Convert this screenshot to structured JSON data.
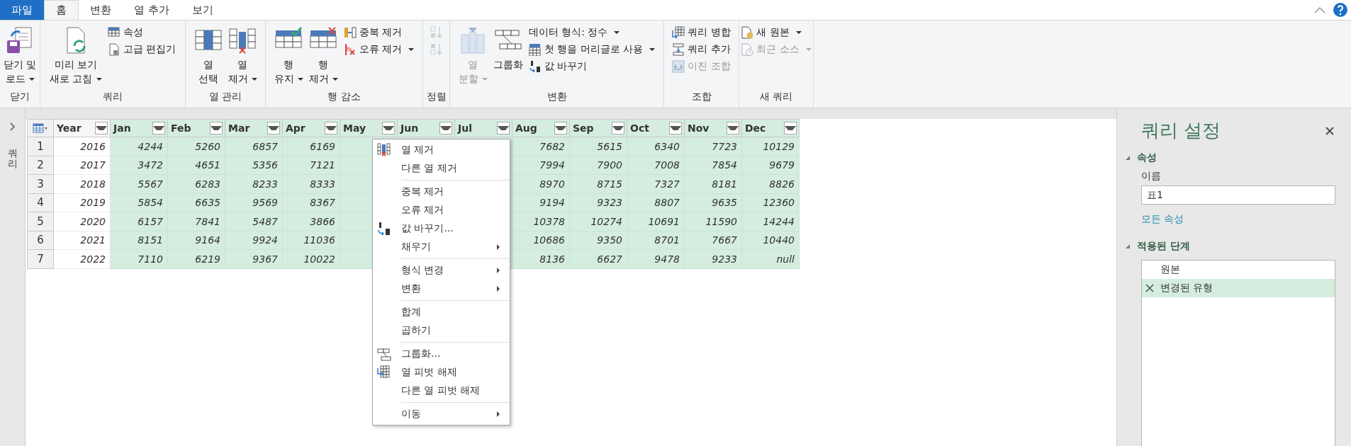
{
  "tabs": [
    {
      "label": "파일",
      "kind": "file",
      "selected": false
    },
    {
      "label": "홈",
      "kind": "tab",
      "selected": true
    },
    {
      "label": "변환",
      "kind": "tab",
      "selected": false
    },
    {
      "label": "열 추가",
      "kind": "tab",
      "selected": false
    },
    {
      "label": "보기",
      "kind": "tab",
      "selected": false
    }
  ],
  "ribbon": {
    "groups": [
      {
        "label": "닫기",
        "buttons": [
          {
            "kind": "large",
            "label": "닫기 및\n로드",
            "dropdown": true,
            "disabled": false
          }
        ]
      },
      {
        "label": "쿼리",
        "buttons": [
          {
            "kind": "large",
            "label": "미리 보기\n새로 고침",
            "dropdown": true,
            "disabled": false
          },
          {
            "kind": "small",
            "label": "속성",
            "dropdown": false,
            "disabled": false
          },
          {
            "kind": "small",
            "label": "고급 편집기",
            "dropdown": false,
            "disabled": false
          }
        ]
      },
      {
        "label": "열 관리",
        "buttons": [
          {
            "kind": "large",
            "label": "열\n선택",
            "dropdown": false,
            "disabled": false
          },
          {
            "kind": "large",
            "label": "열\n제거",
            "dropdown": true,
            "disabled": false
          }
        ]
      },
      {
        "label": "행 감소",
        "buttons": [
          {
            "kind": "large",
            "label": "행\n유지",
            "dropdown": true,
            "disabled": false
          },
          {
            "kind": "large",
            "label": "행\n제거",
            "dropdown": true,
            "disabled": false
          },
          {
            "kind": "small",
            "label": "중복 제거",
            "dropdown": false,
            "disabled": false
          },
          {
            "kind": "small",
            "label": "오류 제거",
            "dropdown": true,
            "disabled": false
          }
        ]
      },
      {
        "label": "정렬",
        "buttons": [
          {
            "kind": "icon",
            "dropdown": false,
            "disabled": true
          },
          {
            "kind": "icon",
            "dropdown": false,
            "disabled": true
          }
        ]
      },
      {
        "label": "변환",
        "buttons": [
          {
            "kind": "large",
            "label": "열\n분할",
            "dropdown": true,
            "disabled": true
          },
          {
            "kind": "large",
            "label": "그룹화",
            "dropdown": false,
            "disabled": false
          },
          {
            "kind": "small",
            "label": "데이터 형식: 정수",
            "dropdown": true,
            "disabled": false
          },
          {
            "kind": "small",
            "label": "첫 행을 머리글로 사용",
            "dropdown": true,
            "disabled": false
          },
          {
            "kind": "small",
            "label": "값 바꾸기",
            "dropdown": false,
            "disabled": false
          }
        ]
      },
      {
        "label": "조합",
        "buttons": [
          {
            "kind": "small",
            "label": "쿼리 병합",
            "dropdown": false,
            "disabled": false
          },
          {
            "kind": "small",
            "label": "쿼리 추가",
            "dropdown": false,
            "disabled": false
          },
          {
            "kind": "small",
            "label": "이진 조합",
            "dropdown": false,
            "disabled": true
          }
        ]
      },
      {
        "label": "새 쿼리",
        "buttons": [
          {
            "kind": "small",
            "label": "새 원본",
            "dropdown": true,
            "disabled": false
          },
          {
            "kind": "small",
            "label": "최근 소스",
            "dropdown": true,
            "disabled": true
          }
        ]
      }
    ]
  },
  "queries_pane": {
    "label": "쿼리"
  },
  "table": {
    "columns": [
      {
        "label": "Year",
        "selected": false
      },
      {
        "label": "Jan",
        "selected": true
      },
      {
        "label": "Feb",
        "selected": true
      },
      {
        "label": "Mar",
        "selected": true
      },
      {
        "label": "Apr",
        "selected": true
      },
      {
        "label": "May",
        "selected": true
      },
      {
        "label": "Jun",
        "selected": true
      },
      {
        "label": "Jul",
        "selected": true
      },
      {
        "label": "Aug",
        "selected": true
      },
      {
        "label": "Sep",
        "selected": true
      },
      {
        "label": "Oct",
        "selected": true
      },
      {
        "label": "Nov",
        "selected": true
      },
      {
        "label": "Dec",
        "selected": true
      }
    ],
    "rows": [
      {
        "number": "1",
        "cells": [
          "2016",
          "4244",
          "5260",
          "6857",
          "6169",
          null,
          null,
          null,
          "7682",
          "5615",
          "6340",
          "7723",
          "10129"
        ]
      },
      {
        "number": "2",
        "cells": [
          "2017",
          "3472",
          "4651",
          "5356",
          "7121",
          null,
          null,
          null,
          "7994",
          "7900",
          "7008",
          "7854",
          "9679"
        ]
      },
      {
        "number": "3",
        "cells": [
          "2018",
          "5567",
          "6283",
          "8233",
          "8333",
          null,
          null,
          null,
          "8970",
          "8715",
          "7327",
          "8181",
          "8826"
        ]
      },
      {
        "number": "4",
        "cells": [
          "2019",
          "5854",
          "6635",
          "9569",
          "8367",
          null,
          null,
          null,
          "9194",
          "9323",
          "8807",
          "9635",
          "12360"
        ]
      },
      {
        "number": "5",
        "cells": [
          "2020",
          "6157",
          "7841",
          "5487",
          "3866",
          null,
          null,
          null,
          "10378",
          "10274",
          "10691",
          "11590",
          "14244"
        ]
      },
      {
        "number": "6",
        "cells": [
          "2021",
          "8151",
          "9164",
          "9924",
          "11036",
          null,
          null,
          null,
          "10686",
          "9350",
          "8701",
          "7667",
          "10440"
        ]
      },
      {
        "number": "7",
        "cells": [
          "2022",
          "7110",
          "6219",
          "9367",
          "10022",
          null,
          null,
          null,
          "8136",
          "6627",
          "9478",
          "9233",
          "null"
        ]
      }
    ]
  },
  "context_menu": {
    "groups": [
      [
        {
          "label": "열 제거",
          "submenu": false
        },
        {
          "label": "다른 열 제거",
          "submenu": false
        }
      ],
      [
        {
          "label": "중복 제거",
          "submenu": false
        },
        {
          "label": "오류 제거",
          "submenu": false
        },
        {
          "label": "값 바꾸기...",
          "submenu": false
        },
        {
          "label": "채우기",
          "submenu": true
        }
      ],
      [
        {
          "label": "형식 변경",
          "submenu": true
        },
        {
          "label": "변환",
          "submenu": true
        }
      ],
      [
        {
          "label": "합계",
          "submenu": false
        },
        {
          "label": "곱하기",
          "submenu": false
        }
      ],
      [
        {
          "label": "그룹화...",
          "submenu": false
        },
        {
          "label": "열 피벗 해제",
          "submenu": false
        },
        {
          "label": "다른 열 피벗 해제",
          "submenu": false
        }
      ],
      [
        {
          "label": "이동",
          "submenu": true
        }
      ]
    ]
  },
  "query_settings": {
    "title": "쿼리 설정",
    "sections": [
      {
        "title": "속성",
        "expanded": true
      },
      {
        "title": "적용된 단계",
        "expanded": true
      }
    ],
    "name_label": "이름",
    "name_value": "표1",
    "all_properties_link": "모든 속성",
    "steps": [
      {
        "label": "원본",
        "selected": false
      },
      {
        "label": "변경된 유형",
        "selected": true
      }
    ]
  }
}
